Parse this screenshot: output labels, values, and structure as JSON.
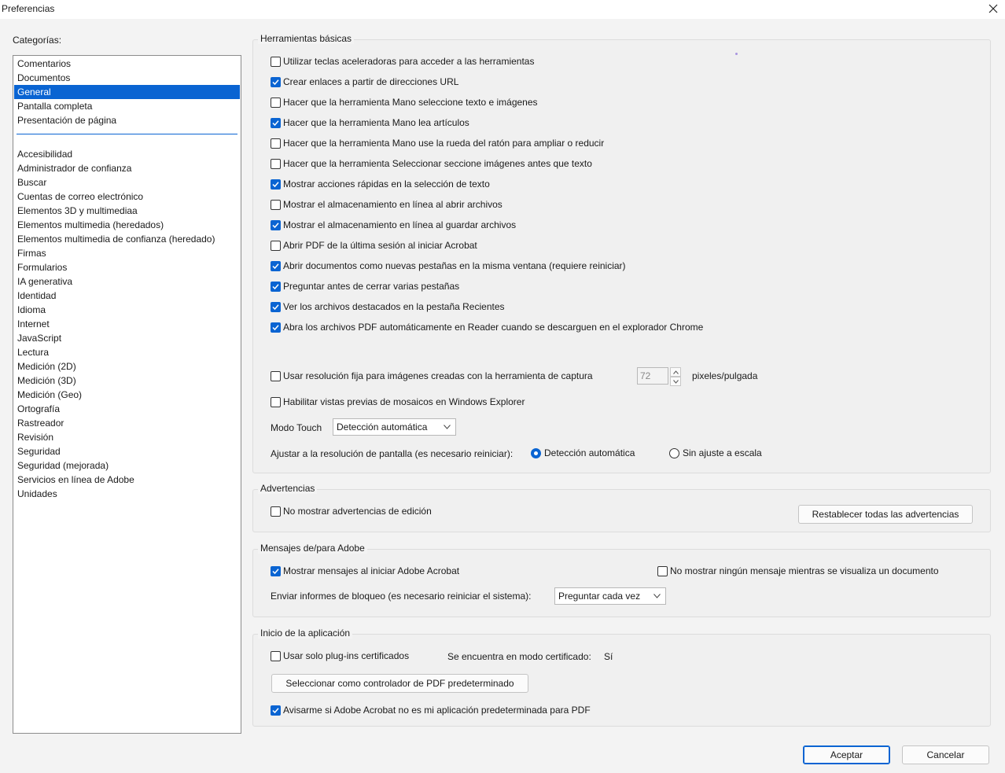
{
  "window": {
    "title": "Preferencias"
  },
  "categories": {
    "label": "Categorías:",
    "top_items": [
      "Comentarios",
      "Documentos",
      "General",
      "Pantalla completa",
      "Presentación de página"
    ],
    "selected": "General",
    "items": [
      "Accesibilidad",
      "Administrador de confianza",
      "Buscar",
      "Cuentas de correo electrónico",
      "Elementos 3D y multimediaa",
      "Elementos multimedia (heredados)",
      "Elementos multimedia de confianza (heredado)",
      "Firmas",
      "Formularios",
      "IA generativa",
      "Identidad",
      "Idioma",
      "Internet",
      "JavaScript",
      "Lectura",
      "Medición (2D)",
      "Medición (3D)",
      "Medición (Geo)",
      "Ortografía",
      "Rastreador",
      "Revisión",
      "Seguridad",
      "Seguridad (mejorada)",
      "Servicios en línea de Adobe",
      "Unidades"
    ]
  },
  "basic_tools": {
    "title": "Herramientas básicas",
    "options": [
      {
        "label": "Utilizar teclas aceleradoras para acceder a las herramientas",
        "checked": false
      },
      {
        "label": "Crear enlaces a partir de direcciones URL",
        "checked": true
      },
      {
        "label": "Hacer que la herramienta Mano seleccione texto e imágenes",
        "checked": false
      },
      {
        "label": "Hacer que la herramienta Mano lea artículos",
        "checked": true
      },
      {
        "label": "Hacer que la herramienta Mano use la rueda del ratón para ampliar o reducir",
        "checked": false
      },
      {
        "label": "Hacer que la herramienta Seleccionar seccione imágenes antes que texto",
        "checked": false
      },
      {
        "label": "Mostrar acciones rápidas en la selección de texto",
        "checked": true
      },
      {
        "label": "Mostrar el almacenamiento en línea al abrir archivos",
        "checked": false
      },
      {
        "label": "Mostrar el almacenamiento en línea al guardar archivos",
        "checked": true
      },
      {
        "label": "Abrir PDF de la última sesión al iniciar Acrobat",
        "checked": false
      },
      {
        "label": "Abrir documentos como nuevas pestañas en la misma ventana (requiere reiniciar)",
        "checked": true
      },
      {
        "label": "Preguntar antes de cerrar varias pestañas",
        "checked": true
      },
      {
        "label": "Ver los archivos destacados en la pestaña Recientes",
        "checked": true
      },
      {
        "label": "Abra los archivos PDF automáticamente en Reader cuando se descarguen en el explorador Chrome",
        "checked": true
      }
    ],
    "fixed_resolution": {
      "label": "Usar resolución fija para imágenes creadas con la herramienta de captura",
      "checked": false,
      "value": "72",
      "unit": "pixeles/pulgada"
    },
    "thumbnails": {
      "label": "Habilitar vistas previas de mosaicos en Windows Explorer",
      "checked": false
    },
    "touch_mode": {
      "label": "Modo Touch",
      "value": "Detección automática"
    },
    "screen_scale": {
      "label": "Ajustar a la resolución de pantalla (es necesario reiniciar):",
      "option_auto": "Detección automática",
      "option_none": "Sin ajuste a escala",
      "selected": "auto"
    }
  },
  "warnings": {
    "title": "Advertencias",
    "no_edit_warnings": {
      "label": "No mostrar advertencias de edición",
      "checked": false
    },
    "reset_button": "Restablecer todas las advertencias"
  },
  "messages": {
    "title": "Mensajes de/para Adobe",
    "show_on_start": {
      "label": "Mostrar mensajes al iniciar Adobe Acrobat",
      "checked": true
    },
    "no_messages_viewing": {
      "label": "No mostrar ningún mensaje mientras se visualiza un documento",
      "checked": false
    },
    "crash_reports": {
      "label": "Enviar informes de bloqueo (es necesario reiniciar el sistema):",
      "value": "Preguntar cada vez"
    }
  },
  "startup": {
    "title": "Inicio de la aplicación",
    "certified_plugins": {
      "label": "Usar solo plug-ins certificados",
      "checked": false
    },
    "certified_mode_label": "Se encuentra en modo certificado:",
    "certified_mode_value": "Sí",
    "default_handler_button": "Seleccionar como controlador de PDF predeterminado",
    "notify_default": {
      "label": "Avisarme si Adobe Acrobat no es mi aplicación predeterminada para PDF",
      "checked": true
    }
  },
  "footer": {
    "ok": "Aceptar",
    "cancel": "Cancelar"
  },
  "colors": {
    "accent": "#0a64d2",
    "background": "#f3f3f3"
  }
}
